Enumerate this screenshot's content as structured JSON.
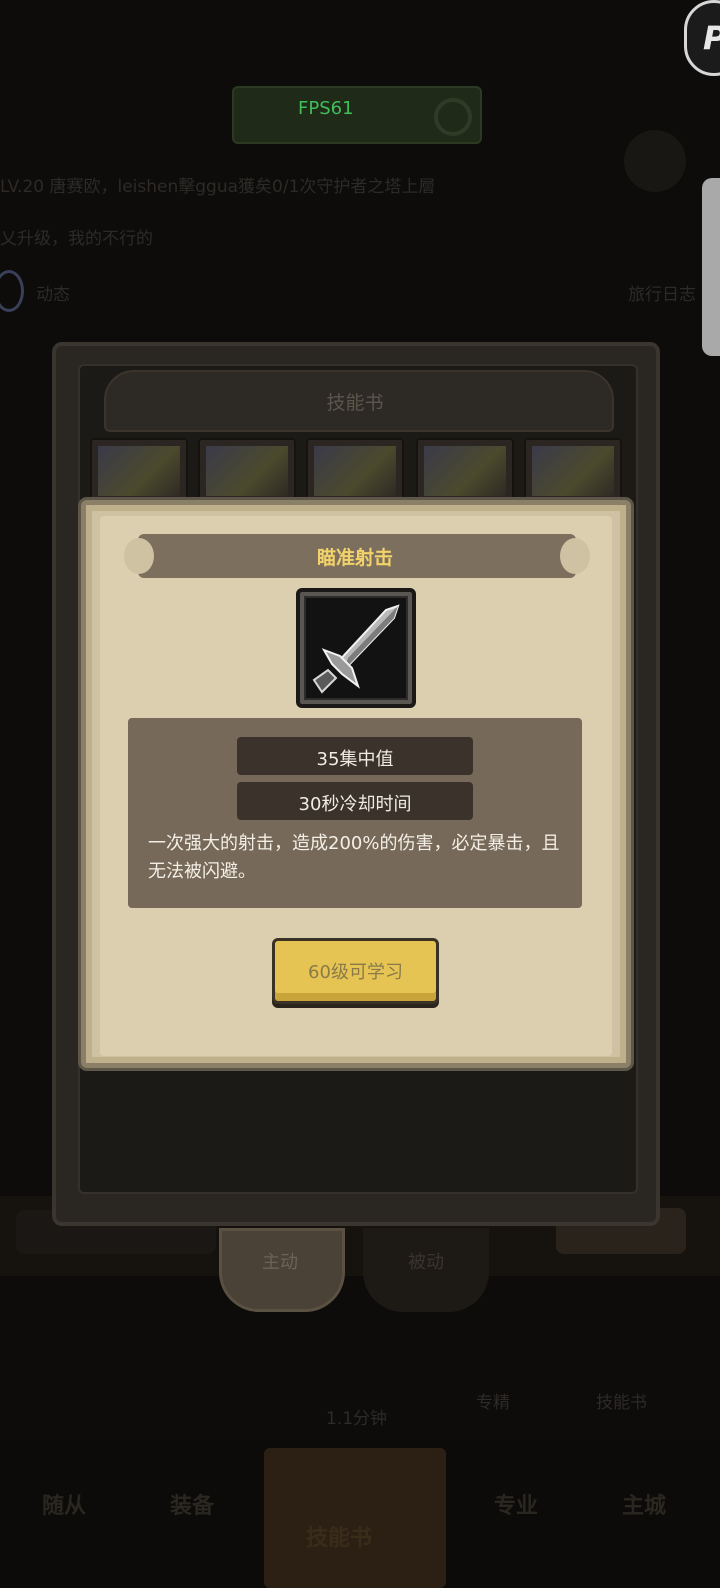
{
  "hud": {
    "fps": "FPS61",
    "corner_badge": "P"
  },
  "background": {
    "chat_line_1": "LV.20 唐赛欧，leishen擊ggua獲矣0/1次守护者之塔上層",
    "chat_line_2": "乂升级，我的不行的",
    "left_label": "动态",
    "right_label": "旅行日志",
    "timer": "1.1分钟"
  },
  "skill_book": {
    "title": "技能书",
    "tabs": [
      "主动",
      "被动"
    ],
    "bottom_items": [
      "专精",
      "技能书"
    ]
  },
  "bottom_nav": {
    "items": [
      "随从",
      "装备",
      "技能书",
      "专业",
      "主城"
    ]
  },
  "modal": {
    "title": "瞄准射击",
    "icon": "sword-icon",
    "stats": [
      "35集中值",
      "30秒冷却时间"
    ],
    "description": "一次强大的射击，造成200%的伤害，必定暴击，且无法被闪避。",
    "learn_button": "60级可学习"
  }
}
